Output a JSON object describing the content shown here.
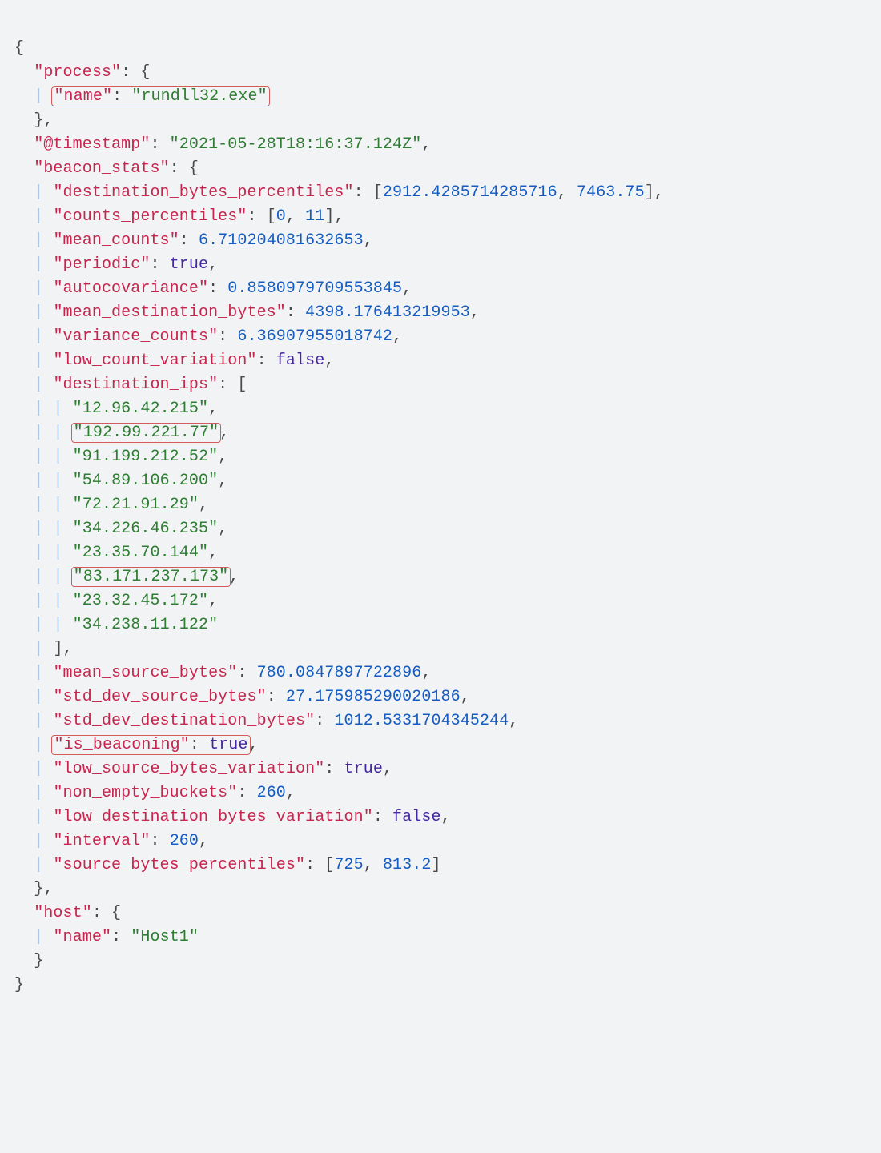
{
  "process_key": "\"process\"",
  "name_key": "\"name\"",
  "process_name_val": "\"rundll32.exe\"",
  "ts_key": "\"@timestamp\"",
  "ts_val": "\"2021-05-28T18:16:37.124Z\"",
  "bs_key": "\"beacon_stats\"",
  "dbp_key": "\"destination_bytes_percentiles\"",
  "dbp_v0": "2912.4285714285716",
  "dbp_v1": "7463.75",
  "cp_key": "\"counts_percentiles\"",
  "cp_v0": "0",
  "cp_v1": "11",
  "mc_key": "\"mean_counts\"",
  "mc_val": "6.710204081632653",
  "per_key": "\"periodic\"",
  "per_val": "true",
  "ac_key": "\"autocovariance\"",
  "ac_val": "0.8580979709553845",
  "mdb_key": "\"mean_destination_bytes\"",
  "mdb_val": "4398.176413219953",
  "vc_key": "\"variance_counts\"",
  "vc_val": "6.36907955018742",
  "lcv_key": "\"low_count_variation\"",
  "lcv_val": "false",
  "dip_key": "\"destination_ips\"",
  "ip0": "\"12.96.42.215\"",
  "ip1": "\"192.99.221.77\"",
  "ip2": "\"91.199.212.52\"",
  "ip3": "\"54.89.106.200\"",
  "ip4": "\"72.21.91.29\"",
  "ip5": "\"34.226.46.235\"",
  "ip6": "\"23.35.70.144\"",
  "ip7": "\"83.171.237.173\"",
  "ip8": "\"23.32.45.172\"",
  "ip9": "\"34.238.11.122\"",
  "msb_key": "\"mean_source_bytes\"",
  "msb_val": "780.0847897722896",
  "sdsb_key": "\"std_dev_source_bytes\"",
  "sdsb_val": "27.175985290020186",
  "sddb_key": "\"std_dev_destination_bytes\"",
  "sddb_val": "1012.5331704345244",
  "ib_key": "\"is_beaconing\"",
  "ib_val": "true",
  "lsbv_key": "\"low_source_bytes_variation\"",
  "lsbv_val": "true",
  "neb_key": "\"non_empty_buckets\"",
  "neb_val": "260",
  "ldbv_key": "\"low_destination_bytes_variation\"",
  "ldbv_val": "false",
  "int_key": "\"interval\"",
  "int_val": "260",
  "sbp_key": "\"source_bytes_percentiles\"",
  "sbp_v0": "725",
  "sbp_v1": "813.2",
  "host_key": "\"host\"",
  "host_name_key": "\"name\"",
  "host_name_val": "\"Host1\""
}
